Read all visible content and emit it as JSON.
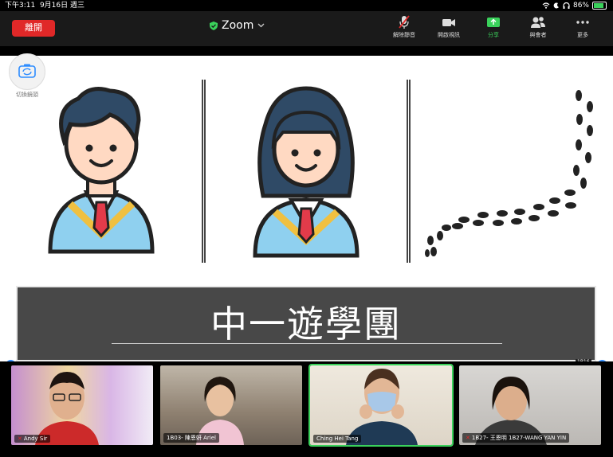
{
  "status_bar": {
    "time": "下午3:11",
    "date": "9月16日 週三",
    "battery": "86%"
  },
  "header": {
    "leave_label": "離開",
    "title": "Zoom"
  },
  "toolbar": [
    {
      "id": "mute",
      "label": "解除靜音"
    },
    {
      "id": "video",
      "label": "開啟視訊"
    },
    {
      "id": "share",
      "label": "分享"
    },
    {
      "id": "participants",
      "label": "與會者"
    },
    {
      "id": "more",
      "label": "更多"
    }
  ],
  "camera_switch": {
    "label": "切換鏡頭"
  },
  "slide": {
    "title": "中一遊學團"
  },
  "video_badge": "1B16",
  "participants": [
    {
      "name": "Andy Sir",
      "muted": true
    },
    {
      "name": "1B03- 陳恩妍 Ariel",
      "muted": false
    },
    {
      "name": "Ching Hei Tang",
      "muted": false
    },
    {
      "name": "1B27- 王恩明 1B27-WANG YAN YIN",
      "muted": true
    }
  ],
  "colors": {
    "leave": "#e02828",
    "share": "#3ad15b",
    "accent": "#2d8cff"
  }
}
